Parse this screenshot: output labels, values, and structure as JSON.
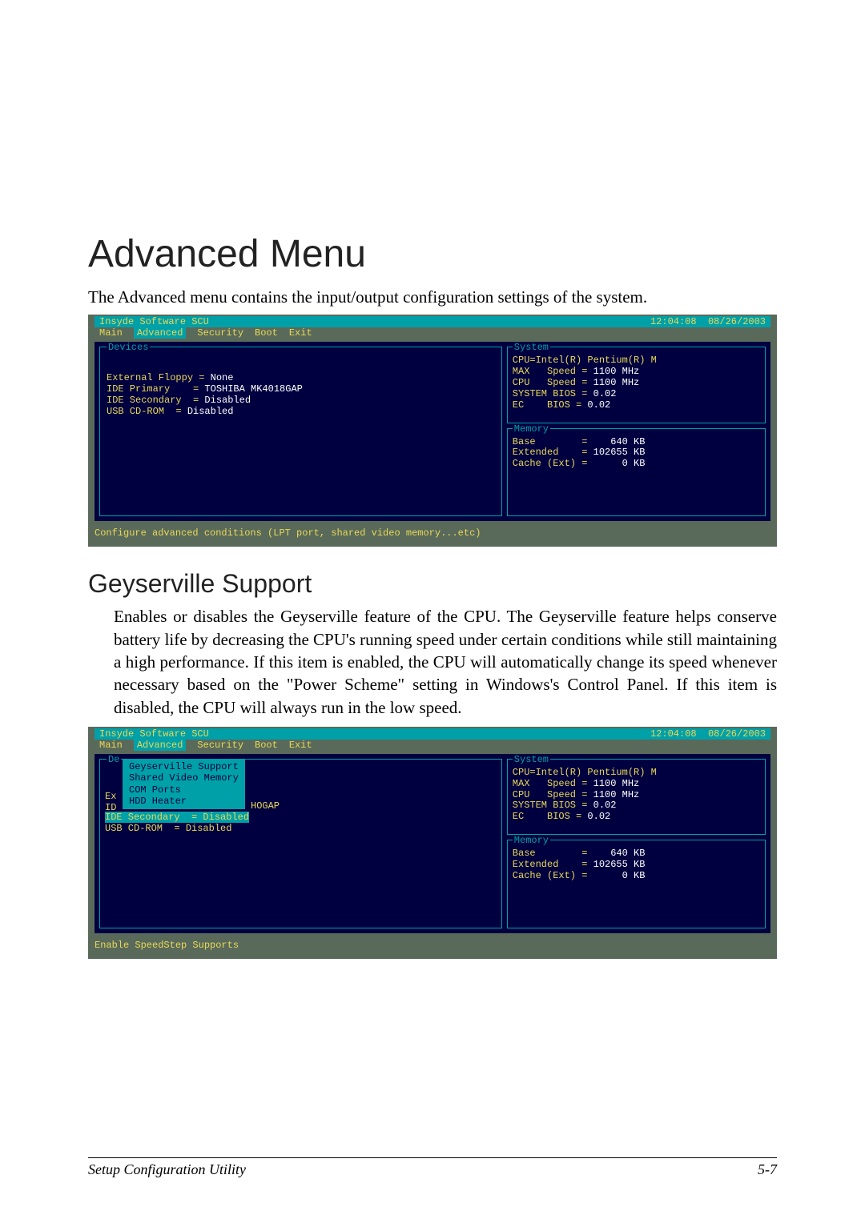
{
  "page": {
    "title": "Advanced Menu",
    "intro": "The Advanced menu contains the input/output configuration settings of the system.",
    "sub_title": "Geyserville Support",
    "body": "Enables or disables the Geyserville feature of the CPU. The Geyserville feature helps conserve battery life by decreasing the CPU's running speed under certain conditions while still maintaining a high performance. If this item is enabled, the CPU will automatically change its speed whenever necessary based on the \"Power Scheme\" setting in Windows's Control Panel. If this item is disabled, the CPU will always run in the low speed.",
    "footer_left": "Setup Configuration Utility",
    "footer_right": "5-7"
  },
  "bios_common": {
    "titlebar_left": "Insyde Software SCU",
    "titlebar_time": "12:04:08",
    "titlebar_date": "08/26/2003",
    "menus": {
      "main": "Main",
      "advanced": "Advanced",
      "security": "Security",
      "boot": "Boot",
      "exit": "Exit"
    },
    "system_label": "System",
    "memory_label": "Memory",
    "devices_label": "Devices",
    "system": {
      "l1": "CPU=Intel(R) Pentium(R) M",
      "l2a": "MAX   Speed =",
      "l2b": " 1100 MHz",
      "l3a": "CPU   Speed =",
      "l3b": " 1100 MHz",
      "l4a": "SYSTEM BIOS =",
      "l4b": " 0.02",
      "l5a": "EC    BIOS =",
      "l5b": " 0.02"
    },
    "memory": {
      "l1a": "Base        =",
      "l1b": "    640 KB",
      "l2a": "Extended    =",
      "l2b": " 102655 KB",
      "l3a": "Cache (Ext) =",
      "l3b": "      0 KB"
    }
  },
  "bios1": {
    "devices": {
      "l1a": "External Floppy =",
      "l1b": " None",
      "l2a": "IDE Primary    =",
      "l2b": " TOSHIBA MK4018GAP",
      "l3a": "IDE Secondary  =",
      "l3b": " Disabled",
      "l4a": "USB CD-ROM  =",
      "l4b": " Disabled"
    },
    "help": "Configure advanced conditions (LPT port, shared video memory...etc)"
  },
  "bios2": {
    "popup": {
      "l1": "Geyserville Support",
      "l2": "Shared Video Memory",
      "l3": "COM Ports",
      "l4": "HDD Heater"
    },
    "left_bg": {
      "a": "De",
      "b": "Ex",
      "c": "ID",
      "d": "IDE Secondary  = Disabled",
      "e": "USB CD-ROM  = Disabled",
      "gap": "HOGAP"
    },
    "help": "Enable SpeedStep Supports"
  }
}
